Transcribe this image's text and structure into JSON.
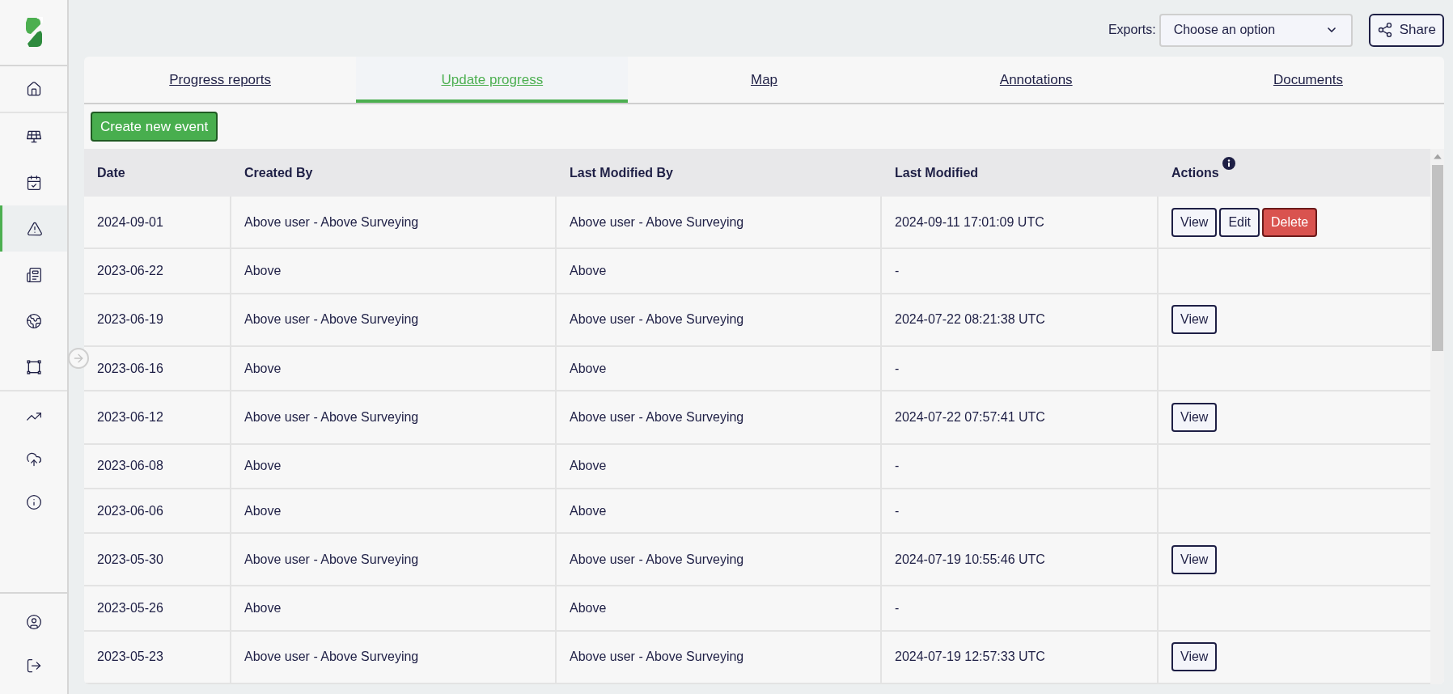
{
  "sidebar": {
    "items": [
      {
        "selected": false
      },
      {
        "selected": false
      },
      {
        "selected": false
      },
      {
        "selected": true
      },
      {
        "selected": false
      },
      {
        "selected": false
      },
      {
        "selected": false
      },
      {
        "selected": false
      },
      {
        "selected": false
      },
      {
        "selected": false
      }
    ],
    "footer_items": [
      {
        "selected": false
      },
      {
        "selected": false
      }
    ]
  },
  "toolbar": {
    "exports_label": "Exports:",
    "exports_select": "Choose an option",
    "share_button": "Share"
  },
  "tabs": [
    {
      "label": "Progress reports",
      "selected": false
    },
    {
      "label": "Update progress",
      "selected": true
    },
    {
      "label": "Map",
      "selected": false
    },
    {
      "label": "Annotations",
      "selected": false
    },
    {
      "label": "Documents",
      "selected": false
    }
  ],
  "create_button": "Create new event",
  "table": {
    "columns": [
      "Date",
      "Created By",
      "Last Modified By",
      "Last Modified",
      "Actions"
    ],
    "rows": [
      {
        "date": "2024-09-01",
        "created_by": "Above user - Above Surveying",
        "last_modified_by": "Above user - Above Surveying",
        "last_modified": "2024-09-11 17:01:09 UTC",
        "actions": [
          {
            "label": "View",
            "kind": "view"
          },
          {
            "label": "Edit",
            "kind": "edit"
          },
          {
            "label": "Delete",
            "kind": "delete"
          }
        ]
      },
      {
        "date": "2023-06-22",
        "created_by": "Above",
        "last_modified_by": "Above",
        "last_modified": "-",
        "actions": []
      },
      {
        "date": "2023-06-19",
        "created_by": "Above user - Above Surveying",
        "last_modified_by": "Above user - Above Surveying",
        "last_modified": "2024-07-22 08:21:38 UTC",
        "actions": [
          {
            "label": "View",
            "kind": "view"
          }
        ]
      },
      {
        "date": "2023-06-16",
        "created_by": "Above",
        "last_modified_by": "Above",
        "last_modified": "-",
        "actions": []
      },
      {
        "date": "2023-06-12",
        "created_by": "Above user - Above Surveying",
        "last_modified_by": "Above user - Above Surveying",
        "last_modified": "2024-07-22 07:57:41 UTC",
        "actions": [
          {
            "label": "View",
            "kind": "view"
          }
        ]
      },
      {
        "date": "2023-06-08",
        "created_by": "Above",
        "last_modified_by": "Above",
        "last_modified": "-",
        "actions": []
      },
      {
        "date": "2023-06-06",
        "created_by": "Above",
        "last_modified_by": "Above",
        "last_modified": "-",
        "actions": []
      },
      {
        "date": "2023-05-30",
        "created_by": "Above user - Above Surveying",
        "last_modified_by": "Above user - Above Surveying",
        "last_modified": "2024-07-19 10:55:46 UTC",
        "actions": [
          {
            "label": "View",
            "kind": "view"
          }
        ]
      },
      {
        "date": "2023-05-26",
        "created_by": "Above",
        "last_modified_by": "Above",
        "last_modified": "-",
        "actions": []
      },
      {
        "date": "2023-05-23",
        "created_by": "Above user - Above Surveying",
        "last_modified_by": "Above user - Above Surveying",
        "last_modified": "2024-07-19 12:57:33 UTC",
        "actions": [
          {
            "label": "View",
            "kind": "view"
          }
        ]
      }
    ]
  }
}
